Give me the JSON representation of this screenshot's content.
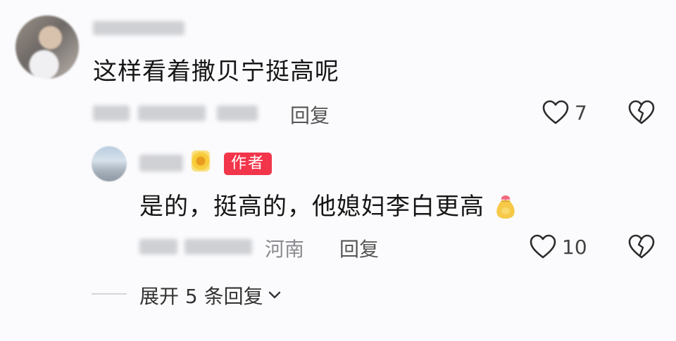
{
  "comment": {
    "text": "这样看着撒贝宁挺高呢",
    "reply_label": "回复",
    "like_count": "7"
  },
  "reply": {
    "author_badge": "作者",
    "text": "是的，挺高的，他媳妇李白更高",
    "location": "河南",
    "reply_label": "回复",
    "like_count": "10",
    "emoji": "🙏"
  },
  "expand": {
    "label": "展开 5 条回复"
  },
  "colors": {
    "badge": "#f2354a",
    "background": "#fbfbfd"
  }
}
